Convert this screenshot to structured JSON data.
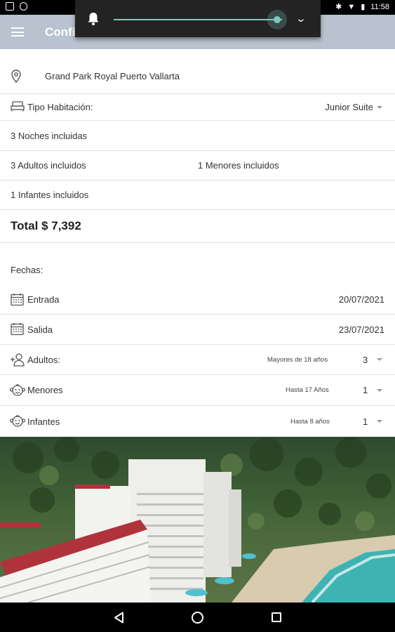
{
  "status_bar": {
    "time": "11:58"
  },
  "app_bar": {
    "title": "Confi"
  },
  "volume": {
    "level": 0.97
  },
  "hotel": {
    "name": "Grand Park Royal Puerto Vallarta"
  },
  "room": {
    "label": "Tipo Habitación:",
    "value": "Junior Suite"
  },
  "summary": {
    "nights": "3 Noches incluidas",
    "adults": "3 Adultos incluidos",
    "minors": "1 Menores incluidos",
    "infants": "1 Infantes incluidos",
    "total": "Total $ 7,392"
  },
  "dates": {
    "heading": "Fechas:",
    "checkin_label": "Entrada",
    "checkin_value": "20/07/2021",
    "checkout_label": "Salida",
    "checkout_value": "23/07/2021"
  },
  "guests": {
    "adults": {
      "label": "Adultos:",
      "hint": "Mayores de 18 años",
      "value": "3"
    },
    "minors": {
      "label": "Menores",
      "hint": "Hasta 17 Años",
      "value": "1"
    },
    "infants": {
      "label": "Infantes",
      "hint": "Hasta 8 años",
      "value": "1"
    }
  }
}
